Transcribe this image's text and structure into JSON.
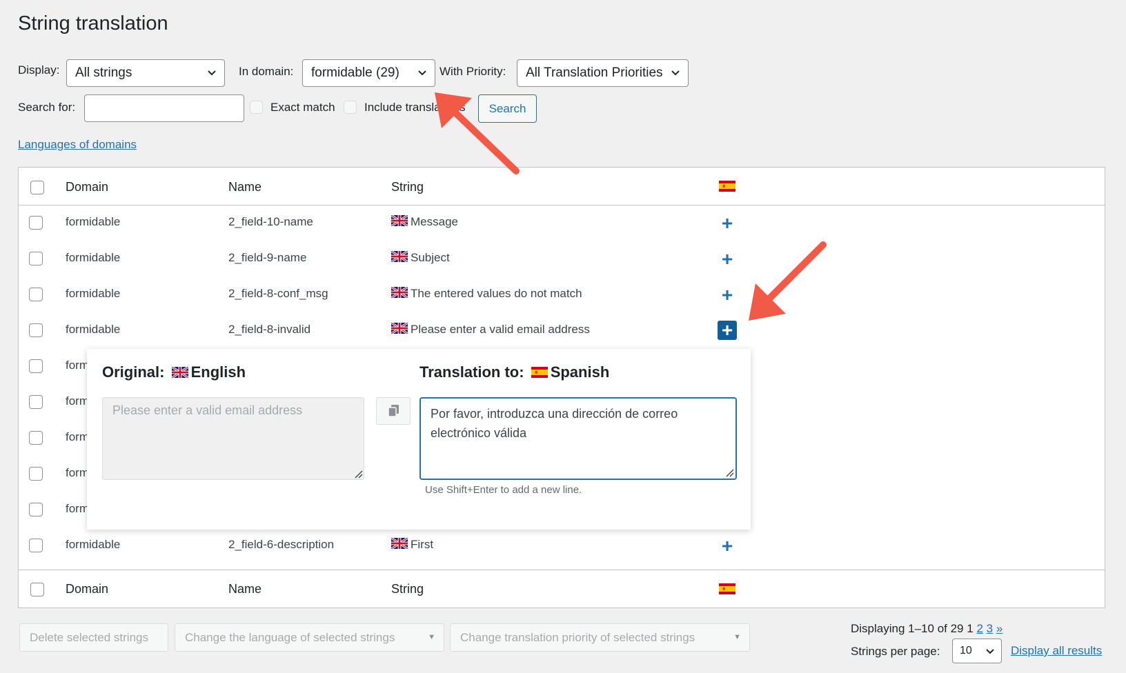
{
  "page": {
    "title": "String translation"
  },
  "filters": {
    "display_label": "Display:",
    "display_value": "All strings",
    "domain_label": "In domain:",
    "domain_value": "formidable (29)",
    "priority_label": "With Priority:",
    "priority_value": "All Translation Priorities",
    "search_label": "Search for:",
    "search_value": "",
    "exact_match_label": "Exact match",
    "include_translations_label": "Include translations",
    "search_button": "Search",
    "languages_link": "Languages of domains"
  },
  "table": {
    "headers": {
      "domain": "Domain",
      "name": "Name",
      "string": "String"
    },
    "rows": [
      {
        "domain": "formidable",
        "name": "2_field-10-name",
        "string": "Message"
      },
      {
        "domain": "formidable",
        "name": "2_field-9-name",
        "string": "Subject"
      },
      {
        "domain": "formidable",
        "name": "2_field-8-conf_msg",
        "string": "The entered values do not match"
      },
      {
        "domain": "formidable",
        "name": "2_field-8-invalid",
        "string": "Please enter a valid email address"
      },
      {
        "domain": "form",
        "name": "",
        "string": ""
      },
      {
        "domain": "form",
        "name": "",
        "string": ""
      },
      {
        "domain": "form",
        "name": "",
        "string": ""
      },
      {
        "domain": "form",
        "name": "",
        "string": ""
      },
      {
        "domain": "form",
        "name": "",
        "string": ""
      },
      {
        "domain": "formidable",
        "name": "2_field-6-description",
        "string": "First"
      }
    ]
  },
  "popup": {
    "original_label": "Original:",
    "original_language": "English",
    "translation_label": "Translation to:",
    "translation_language": "Spanish",
    "original_placeholder": "Please enter a valid email address",
    "translation_value": "Por favor, introduzca una dirección de correo electrónico válida",
    "hint": "Use Shift+Enter to add a new line."
  },
  "bulk_actions": {
    "delete": "Delete selected strings",
    "change_language": "Change the language of selected strings",
    "change_priority": "Change translation priority of selected strings"
  },
  "pagination": {
    "displaying": "Displaying 1–10 of 29",
    "current_page": "1",
    "page_2": "2",
    "page_3": "3",
    "next": "»",
    "per_page_label": "Strings per page:",
    "per_page_value": "10",
    "display_all": "Display all results"
  },
  "colors": {
    "accent": "#2271b1",
    "arrow": "#f05a47"
  }
}
